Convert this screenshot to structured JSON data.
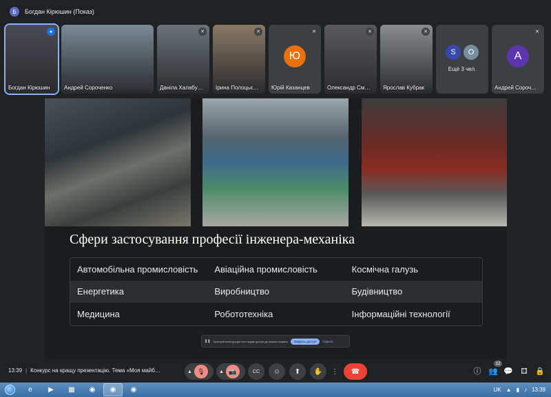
{
  "window": {
    "avatar_letter": "Б",
    "title": "Богдан Кірюшин (Показ)"
  },
  "participants": [
    {
      "name": "Богдан Кірюшин",
      "mic": "speaking",
      "tint": "#4a4a52"
    },
    {
      "name": "Андрей Сороченко",
      "mic": "",
      "tint": "#7a8a96"
    },
    {
      "name": "Даніла Халабу…",
      "mic": "muted",
      "tint": "#6b7378"
    },
    {
      "name": "Ірина Полоцьє…",
      "mic": "muted",
      "tint": "#8a7a66"
    },
    {
      "name": "Юрій Казанцев",
      "mic": "muted",
      "initial": "Ю",
      "color": "#e8710a"
    },
    {
      "name": "Олександр См…",
      "mic": "muted",
      "tint": "#5a5a5e"
    },
    {
      "name": "Ярослав Кубрак",
      "mic": "muted",
      "tint": "#8a8c8e"
    },
    {
      "name": "Андрей Сороч…",
      "mic": "muted",
      "initial": "А",
      "color": "#5e35b1"
    }
  ],
  "more_tile": {
    "label": "Ещё 3 чел.",
    "avatars": [
      {
        "letter": "S",
        "color": "#3949ab"
      },
      {
        "letter": "O",
        "color": "#78909c"
      }
    ]
  },
  "slide": {
    "title": "Сфери застосування професії інженера-механіка",
    "rows": [
      [
        "Автомобільна промисловість",
        "Авіаційна промисловість",
        "Космічна галузь"
      ],
      [
        "Енергетика",
        "Виробництво",
        "Будівництво"
      ],
      [
        "Медицина",
        "Робототехніка",
        "Інформаційні технології"
      ]
    ]
  },
  "share_banner": {
    "text": "Пристрій meet.google.com надає доступ до вашого екрана",
    "stop_label": "Закрыть доступ",
    "hide_label": "Скрыть"
  },
  "meeting": {
    "time": "13:39",
    "title": "Конкурс на кращу презентацію. Тема «Моя майб…"
  },
  "controls_icons": {
    "mic": "🎙",
    "camera": "📷",
    "captions": "CC",
    "emoji": "☺",
    "present": "⬆",
    "hand": "✋",
    "more": "⋮",
    "end": "☎",
    "info": "ⓘ",
    "people": "👥",
    "chat": "💬",
    "activities": "⚃",
    "lock": "🔒"
  },
  "people_count": "12",
  "taskbar": {
    "items": [
      "e",
      "▶",
      "▦",
      "◉",
      "◉",
      "◉"
    ],
    "lang": "UK",
    "clock": "13:39"
  }
}
